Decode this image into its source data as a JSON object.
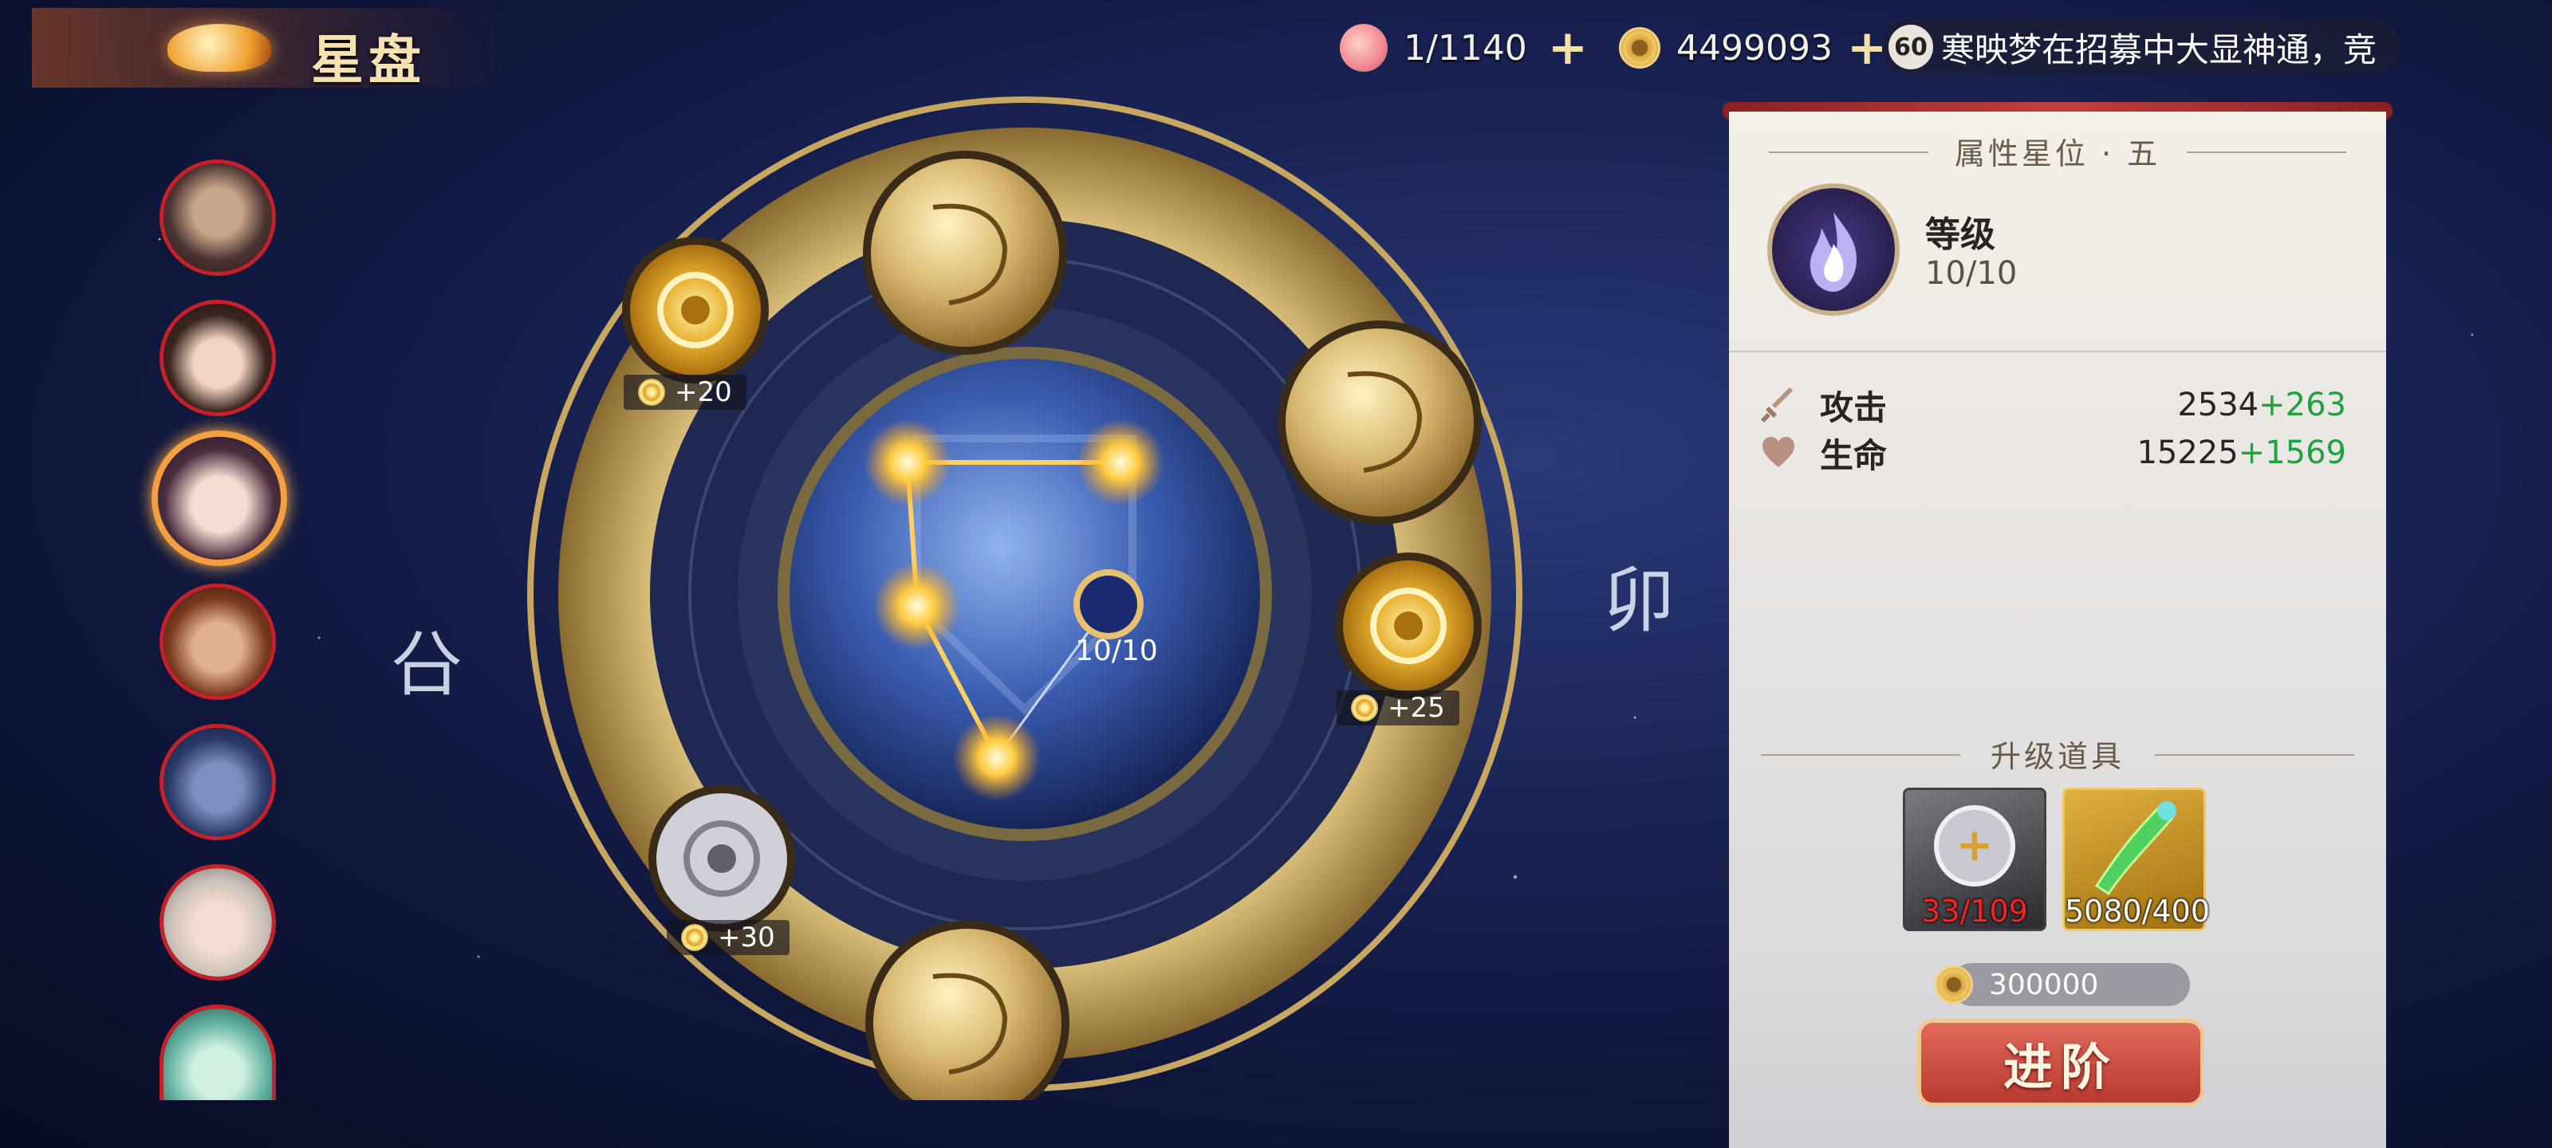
{
  "header": {
    "title": "星盘"
  },
  "currencies": {
    "stamina": "1/1140",
    "coins": "4499093",
    "notice_badge": "60",
    "notice_text": "寒映梦在招募中大显神通，竞"
  },
  "characters": [
    {
      "id": "hero-1",
      "selected": false
    },
    {
      "id": "hero-2",
      "selected": false
    },
    {
      "id": "hero-3",
      "selected": true
    },
    {
      "id": "hero-4",
      "selected": false
    },
    {
      "id": "hero-5",
      "selected": false
    },
    {
      "id": "hero-6",
      "selected": false
    },
    {
      "id": "hero-7",
      "selected": false
    }
  ],
  "disk": {
    "side_left_glyph": "㕣",
    "side_right_glyph": "卯",
    "center_progress": "10/10",
    "bonuses": [
      {
        "label": "+20"
      },
      {
        "label": "+25"
      },
      {
        "label": "+30"
      }
    ]
  },
  "panel": {
    "header": "属性星位 · 五",
    "level_label": "等级",
    "level_value": "10/10",
    "stats": [
      {
        "name": "攻击",
        "value": "2534",
        "add": "+263",
        "icon": "sword-icon"
      },
      {
        "name": "生命",
        "value": "15225",
        "add": "+1569",
        "icon": "heart-icon"
      }
    ],
    "items_header": "升级道具",
    "items": [
      {
        "name": "silver-token-item",
        "count": "33/109",
        "count_color": "#ff2020"
      },
      {
        "name": "jade-scroll-item",
        "count": "5080/400",
        "count_color": "#ffffff"
      }
    ],
    "cost": "300000",
    "advance_label": "进阶"
  },
  "colors": {
    "accent_gold": "#d8b870",
    "positive": "#20a040",
    "insufficient": "#ff2020"
  }
}
